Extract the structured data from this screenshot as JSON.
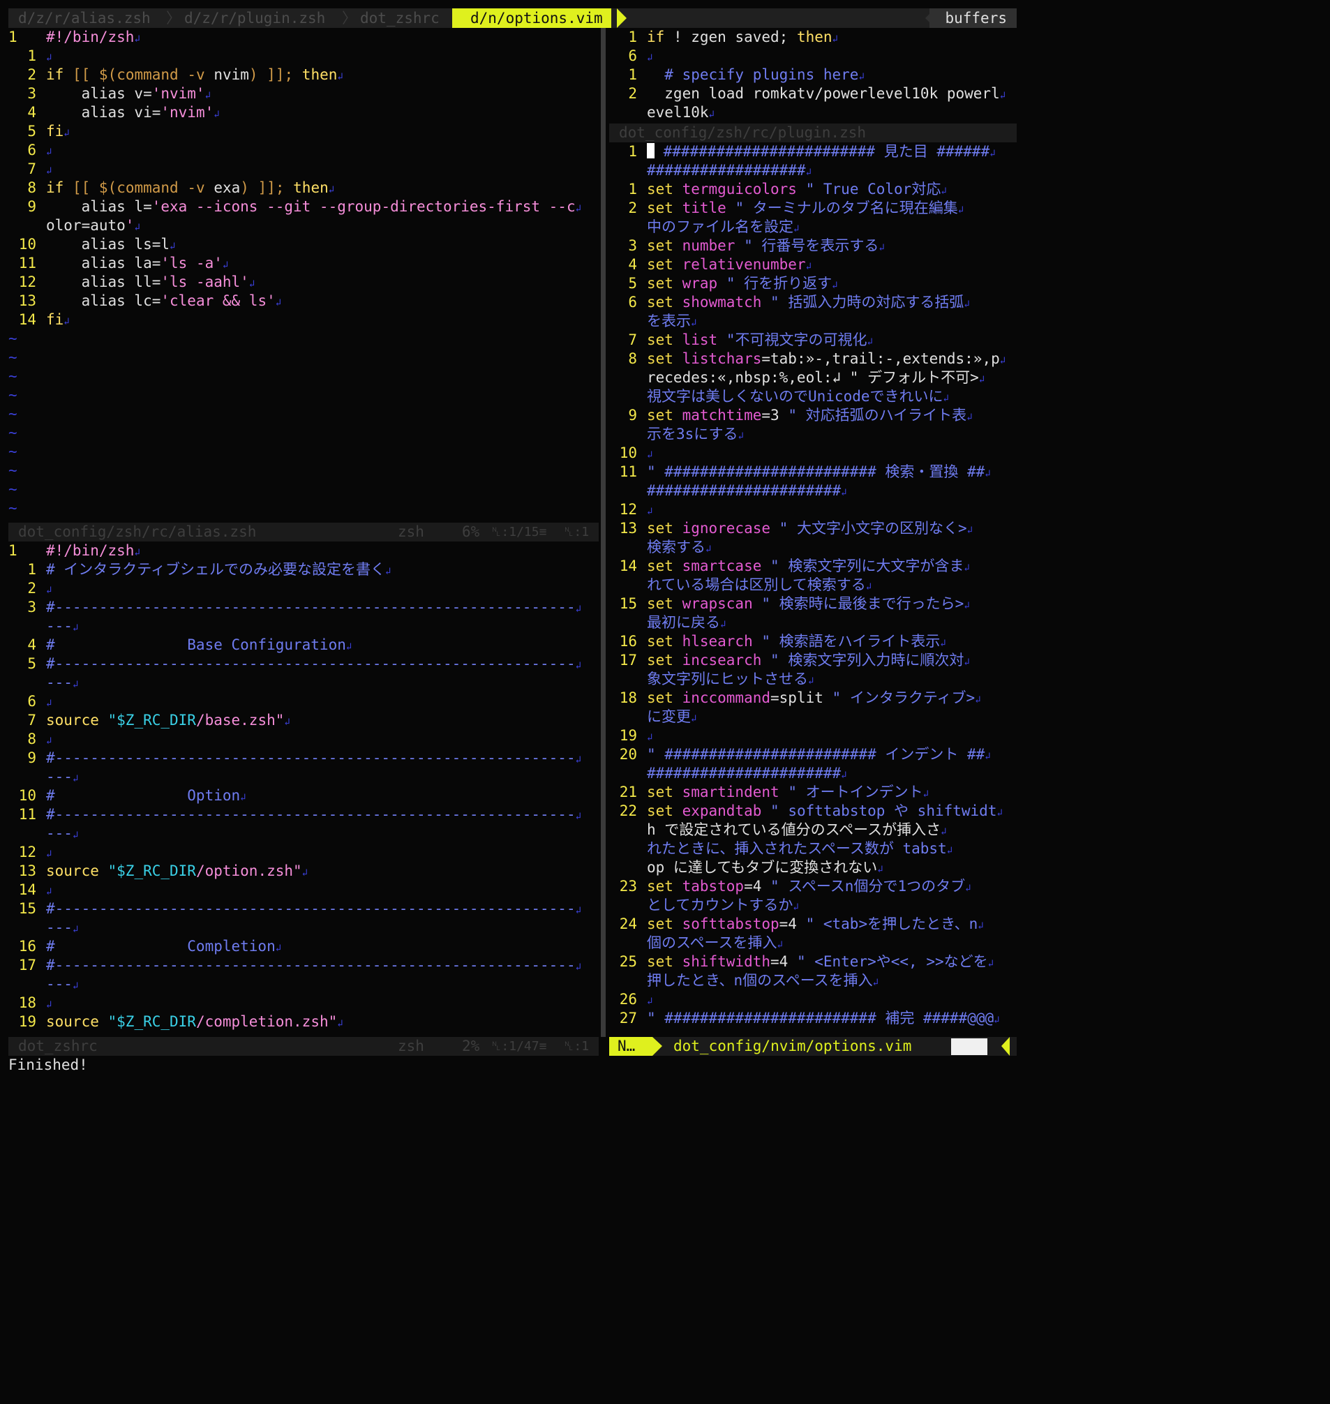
{
  "tabline": {
    "tabs": [
      "d/z/r/alias.zsh",
      "d/z/r/plugin.zsh",
      "dot_zshrc"
    ],
    "active_tab": "d/n/options.vim",
    "separator": "〉",
    "buffers_label": "buffers"
  },
  "left_top": {
    "abs_line": "1",
    "abs_text": "#!/bin/zsh",
    "lines": [
      {
        "n": "1",
        "t": ""
      },
      {
        "n": "2",
        "t": "if [[ $(command -v nvim) ]]; then"
      },
      {
        "n": "3",
        "t": "    alias v='nvim'"
      },
      {
        "n": "4",
        "t": "    alias vi='nvim'"
      },
      {
        "n": "5",
        "t": "fi"
      },
      {
        "n": "6",
        "t": ""
      },
      {
        "n": "7",
        "t": ""
      },
      {
        "n": "8",
        "t": "if [[ $(command -v exa) ]]; then"
      },
      {
        "n": "9",
        "t": "    alias l='exa --icons --git --group-directories-first --c"
      },
      {
        "n": "",
        "t": "olor=auto'"
      },
      {
        "n": "10",
        "t": "    alias ls=l"
      },
      {
        "n": "11",
        "t": "    alias la='ls -a'"
      },
      {
        "n": "12",
        "t": "    alias ll='ls -aahl'"
      },
      {
        "n": "13",
        "t": "    alias lc='clear && ls'"
      },
      {
        "n": "14",
        "t": "fi"
      }
    ],
    "tilde_count": 10,
    "status": {
      "file": "dot_config/zsh/rc/alias.zsh",
      "ft": "zsh",
      "pct": "6%",
      "pos": "␤:1/15≡",
      "col": "␤:1"
    }
  },
  "left_bottom": {
    "abs_line": "1",
    "abs_text": "#!/bin/zsh",
    "lines": [
      {
        "n": "1",
        "t": "# インタラクティブシェルでのみ必要な設定を書く"
      },
      {
        "n": "2",
        "t": ""
      },
      {
        "n": "3",
        "t": "#-----------------------------------------------------------"
      },
      {
        "n": "",
        "t": "---"
      },
      {
        "n": "4",
        "t": "#               Base Configuration"
      },
      {
        "n": "5",
        "t": "#-----------------------------------------------------------"
      },
      {
        "n": "",
        "t": "---"
      },
      {
        "n": "6",
        "t": ""
      },
      {
        "n": "7",
        "t": "source \"$Z_RC_DIR/base.zsh\""
      },
      {
        "n": "8",
        "t": ""
      },
      {
        "n": "9",
        "t": "#-----------------------------------------------------------"
      },
      {
        "n": "",
        "t": "---"
      },
      {
        "n": "10",
        "t": "#               Option"
      },
      {
        "n": "11",
        "t": "#-----------------------------------------------------------"
      },
      {
        "n": "",
        "t": "---"
      },
      {
        "n": "12",
        "t": ""
      },
      {
        "n": "13",
        "t": "source \"$Z_RC_DIR/option.zsh\""
      },
      {
        "n": "14",
        "t": ""
      },
      {
        "n": "15",
        "t": "#-----------------------------------------------------------"
      },
      {
        "n": "",
        "t": "---"
      },
      {
        "n": "16",
        "t": "#               Completion"
      },
      {
        "n": "17",
        "t": "#-----------------------------------------------------------"
      },
      {
        "n": "",
        "t": "---"
      },
      {
        "n": "18",
        "t": ""
      },
      {
        "n": "19",
        "t": "source \"$Z_RC_DIR/completion.zsh\""
      }
    ],
    "status": {
      "file": "dot_zshrc",
      "ft": "zsh",
      "pct": "2%",
      "pos": "␤:1/47≡",
      "col": "␤:1"
    }
  },
  "right_top": {
    "lines": [
      {
        "n": "1",
        "t": "if ! zgen saved; then"
      },
      {
        "n": "6",
        "t": ""
      },
      {
        "n": "1",
        "t": "  # specify plugins here"
      },
      {
        "n": "2",
        "t": "  zgen load romkatv/powerlevel10k powerl"
      },
      {
        "n": "",
        "t": "evel10k"
      }
    ],
    "status": {
      "file": "dot_config/zsh/rc/plugin.zsh"
    }
  },
  "right_bottom": {
    "lines": [
      {
        "n": "1",
        "t": " \" ######################## 見た目 ######"
      },
      {
        "n": "",
        "t": "##################"
      },
      {
        "n": "1",
        "t": "set termguicolors \" True Color対応"
      },
      {
        "n": "2",
        "t": "set title \" ターミナルのタブ名に現在編集"
      },
      {
        "n": "",
        "t": "中のファイル名を設定"
      },
      {
        "n": "3",
        "t": "set number \" 行番号を表示する"
      },
      {
        "n": "4",
        "t": "set relativenumber"
      },
      {
        "n": "5",
        "t": "set wrap \" 行を折り返す"
      },
      {
        "n": "6",
        "t": "set showmatch \" 括弧入力時の対応する括弧"
      },
      {
        "n": "",
        "t": "を表示"
      },
      {
        "n": "7",
        "t": "set list \"不可視文字の可視化"
      },
      {
        "n": "8",
        "t": "set listchars=tab:»-,trail:-,extends:»,p"
      },
      {
        "n": "",
        "t": "recedes:«,nbsp:%,eol:↲ \" デフォルト不可>"
      },
      {
        "n": "",
        "t": "視文字は美しくないのでUnicodeできれいに"
      },
      {
        "n": "9",
        "t": "set matchtime=3 \" 対応括弧のハイライト表"
      },
      {
        "n": "",
        "t": "示を3sにする"
      },
      {
        "n": "10",
        "t": ""
      },
      {
        "n": "11",
        "t": "\" ######################## 検索・置換 ##"
      },
      {
        "n": "",
        "t": "######################"
      },
      {
        "n": "12",
        "t": ""
      },
      {
        "n": "13",
        "t": "set ignorecase \" 大文字小文字の区別なく>"
      },
      {
        "n": "",
        "t": "検索する"
      },
      {
        "n": "14",
        "t": "set smartcase \" 検索文字列に大文字が含ま"
      },
      {
        "n": "",
        "t": "れている場合は区別して検索する"
      },
      {
        "n": "15",
        "t": "set wrapscan \" 検索時に最後まで行ったら>"
      },
      {
        "n": "",
        "t": "最初に戻る"
      },
      {
        "n": "16",
        "t": "set hlsearch \" 検索語をハイライト表示"
      },
      {
        "n": "17",
        "t": "set incsearch \" 検索文字列入力時に順次対"
      },
      {
        "n": "",
        "t": "象文字列にヒットさせる"
      },
      {
        "n": "18",
        "t": "set inccommand=split \" インタラクティブ>"
      },
      {
        "n": "",
        "t": "に変更"
      },
      {
        "n": "19",
        "t": ""
      },
      {
        "n": "20",
        "t": "\" ######################## インデント ##"
      },
      {
        "n": "",
        "t": "######################"
      },
      {
        "n": "21",
        "t": "set smartindent \" オートインデント"
      },
      {
        "n": "22",
        "t": "set expandtab \" softtabstop や shiftwidt"
      },
      {
        "n": "",
        "t": "h で設定されている値分のスペースが挿入さ"
      },
      {
        "n": "",
        "t": "れたときに、挿入されたスペース数が tabst"
      },
      {
        "n": "",
        "t": "op に達してもタブに変換されない"
      },
      {
        "n": "23",
        "t": "set tabstop=4 \" スペースn個分で1つのタブ"
      },
      {
        "n": "",
        "t": "としてカウントするか"
      },
      {
        "n": "24",
        "t": "set softtabstop=4 \" <tab>を押したとき、n"
      },
      {
        "n": "",
        "t": "個のスペースを挿入"
      },
      {
        "n": "25",
        "t": "set shiftwidth=4 \" <Enter>や<<, >>などを"
      },
      {
        "n": "",
        "t": "押したとき、n個のスペースを挿入"
      },
      {
        "n": "26",
        "t": ""
      },
      {
        "n": "27",
        "t": "\" ######################## 補完 #####@@@"
      }
    ],
    "status": {
      "mode": "N…",
      "file": "dot_config/nvim/options.vim"
    }
  },
  "cmdline": {
    "message": "Finished!"
  },
  "colors": {
    "background": "#070707",
    "line_number": "#f4e94a",
    "comment": "#6f7cf0",
    "keyword": "#ffe066",
    "string": "#f58ed9",
    "option": "#e35bd1",
    "variable": "#3ad0e6",
    "accent": "#dff01e"
  }
}
